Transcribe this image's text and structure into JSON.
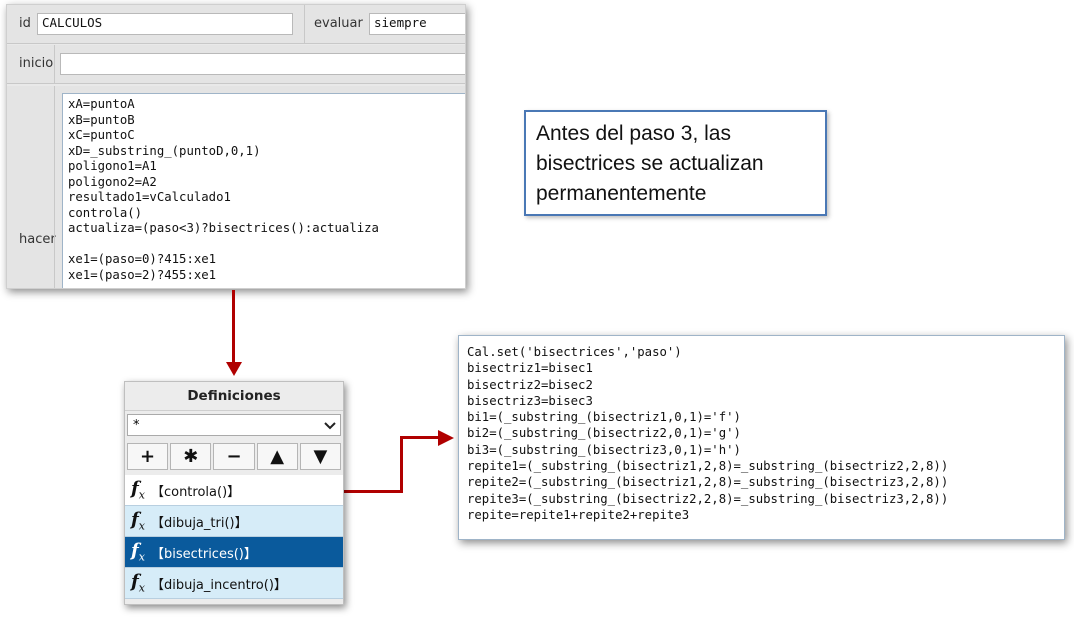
{
  "editor": {
    "id_label": "id",
    "id_value": "CALCULOS",
    "evaluar_label": "evaluar",
    "evaluar_value": "siempre",
    "inicio_label": "inicio",
    "inicio_value": "",
    "hacer_label": "hacer",
    "hacer_code": "xA=puntoA\nxB=puntoB\nxC=puntoC\nxD=_substring_(puntoD,0,1)\npoligono1=A1\npoligono2=A2\nresultado1=vCalculado1\ncontrola()\nactualiza=(paso<3)?bisectrices():actualiza\n\nxe1=(paso=0)?415:xe1\nxe1=(paso=2)?455:xe1"
  },
  "callout": {
    "text": "Antes del paso 3, las bisectrices se actualizan permanentemente"
  },
  "definiciones": {
    "title": "Definiciones",
    "filter_value": "*",
    "buttons": [
      "+",
      "✱",
      "−",
      "▲",
      "▼"
    ],
    "items": [
      {
        "label": "【controla()】"
      },
      {
        "label": "【dibuja_tri()】"
      },
      {
        "label": "【bisectrices()】"
      },
      {
        "label": "【dibuja_incentro()】"
      }
    ]
  },
  "code_panel": {
    "code": "Cal.set('bisectrices','paso')\nbisectriz1=bisec1\nbisectriz2=bisec2\nbisectriz3=bisec3\nbi1=(_substring_(bisectriz1,0,1)='f')\nbi2=(_substring_(bisectriz2,0,1)='g')\nbi3=(_substring_(bisectriz3,0,1)='h')\nrepite1=(_substring_(bisectriz1,2,8)=_substring_(bisectriz2,2,8))\nrepite2=(_substring_(bisectriz1,2,8)=_substring_(bisectriz3,2,8))\nrepite3=(_substring_(bisectriz2,2,8)=_substring_(bisectriz3,2,8))\nrepite=repite1+repite2+repite3"
  },
  "colors": {
    "arrow": "#b00000",
    "selected": "#0a5a9c",
    "callout_border": "#4a78b5"
  }
}
